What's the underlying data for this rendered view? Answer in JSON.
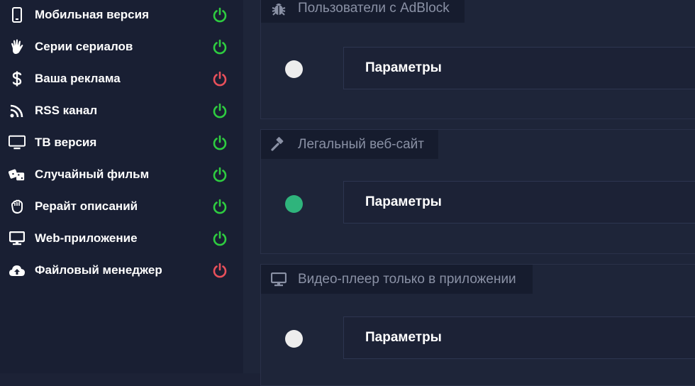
{
  "sidebar": {
    "items": [
      {
        "label": "Мобильная версия",
        "icon": "mobile-phone-icon",
        "status": "on"
      },
      {
        "label": "Серии сериалов",
        "icon": "hand-icon",
        "status": "on"
      },
      {
        "label": "Ваша реклама",
        "icon": "dollar-icon",
        "status": "off"
      },
      {
        "label": "RSS канал",
        "icon": "rss-icon",
        "status": "on"
      },
      {
        "label": "ТВ версия",
        "icon": "tv-icon",
        "status": "on"
      },
      {
        "label": "Случайный фильм",
        "icon": "dice-icon",
        "status": "on"
      },
      {
        "label": "Рерайт описаний",
        "icon": "hand-paper-icon",
        "status": "on"
      },
      {
        "label": "Web-приложение",
        "icon": "desktop-icon",
        "status": "on"
      },
      {
        "label": "Файловый менеджер",
        "icon": "cloud-upload-icon",
        "status": "off"
      }
    ]
  },
  "colors": {
    "power_on": "#2ecc40",
    "power_off": "#e8505b",
    "toggle_on": "#2fb47c",
    "toggle_off": "#ededed"
  },
  "modules": [
    {
      "title": "Пользователи с AdBlock",
      "icon": "bug-icon",
      "enabled": false,
      "button_label": "Параметры"
    },
    {
      "title": "Легальный веб-сайт",
      "icon": "gavel-icon",
      "enabled": true,
      "button_label": "Параметры"
    },
    {
      "title": "Видео-плеер только в приложении",
      "icon": "desktop-icon",
      "enabled": false,
      "button_label": "Параметры"
    }
  ]
}
